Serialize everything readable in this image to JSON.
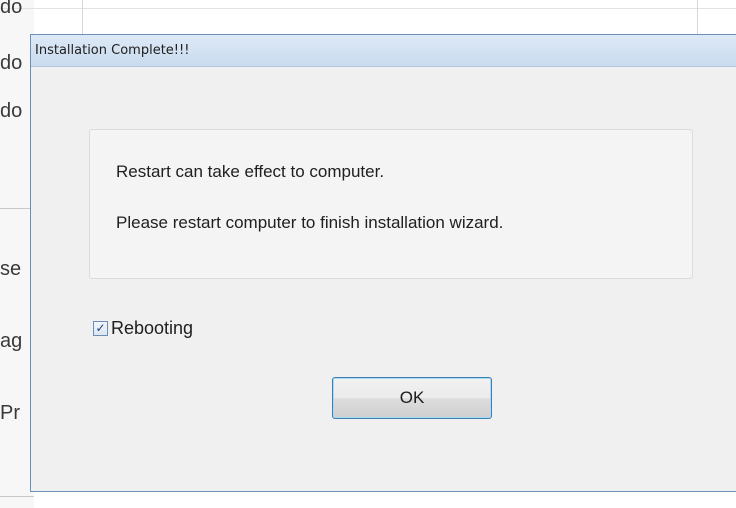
{
  "background_window": {
    "fragments": [
      "do",
      "do",
      "do",
      "se",
      "ag",
      "Pr"
    ]
  },
  "dialog": {
    "title": "Installation Complete!!!",
    "message": {
      "line1": "Restart can take effect to computer.",
      "line2": "Please restart computer to finish installation wizard."
    },
    "checkbox": {
      "label": "Rebooting",
      "checked": true,
      "check_glyph": "✓"
    },
    "ok_button": {
      "label": "OK"
    }
  },
  "colors": {
    "dialog_border": "#6d8fb3",
    "titlebar_top": "#dde9f6",
    "titlebar_bottom": "#c9dbee",
    "button_focus_border": "#3c7fb1",
    "dialog_background": "#f0f0f0"
  }
}
